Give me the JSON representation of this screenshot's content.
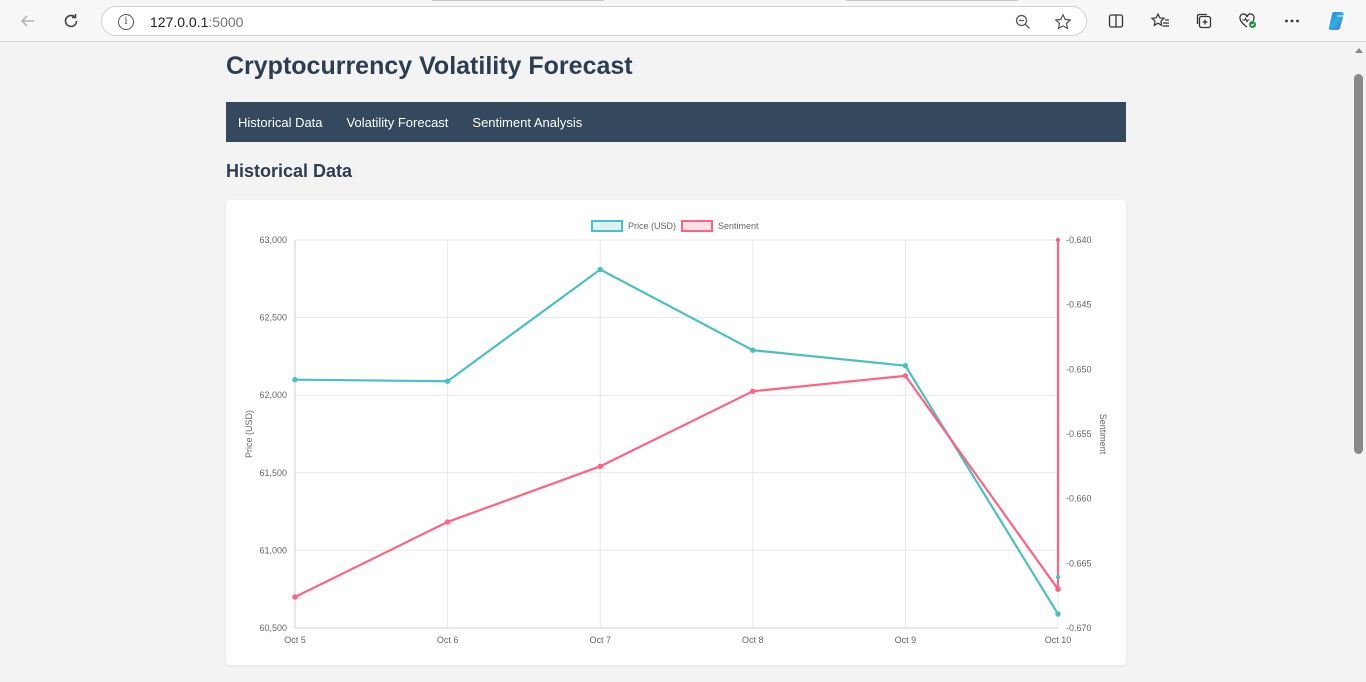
{
  "browser": {
    "url_host": "127.0.0.1",
    "url_port": ":5000"
  },
  "page": {
    "title": "Cryptocurrency Volatility Forecast",
    "section_title": "Historical Data"
  },
  "navbar": {
    "items": [
      {
        "label": "Historical Data"
      },
      {
        "label": "Volatility Forecast"
      },
      {
        "label": "Sentiment Analysis"
      }
    ]
  },
  "colors": {
    "navbar_bg": "#34495e",
    "price_series": "#4bc0c0",
    "sentiment_series": "#ff6384",
    "title_text": "#2c3e50"
  },
  "chart_data": {
    "type": "line",
    "categories": [
      "Oct 5",
      "Oct 6",
      "Oct 7",
      "Oct 8",
      "Oct 9",
      "Oct 10"
    ],
    "series": [
      {
        "name": "Price (USD)",
        "axis": "left",
        "values": [
          62100,
          62090,
          62810,
          62290,
          62190,
          60590
        ],
        "color": "#4bc0c0"
      },
      {
        "name": "Sentiment",
        "axis": "right",
        "values": [
          -0.6676,
          -0.6618,
          -0.6575,
          -0.6517,
          -0.6505,
          -0.667
        ],
        "color": "#ff6384"
      }
    ],
    "ylabel": "Price (USD)",
    "y2label": "Sentiment",
    "ylim": [
      60500,
      63000
    ],
    "y2lim": [
      -0.67,
      -0.64
    ],
    "yticks": [
      "60,500",
      "61,000",
      "61,500",
      "62,000",
      "62,500",
      "63,000"
    ],
    "y2ticks": [
      "-0.670",
      "-0.665",
      "-0.660",
      "-0.655",
      "-0.650",
      "-0.645",
      "-0.640"
    ],
    "legend_position": "top",
    "grid": true
  }
}
